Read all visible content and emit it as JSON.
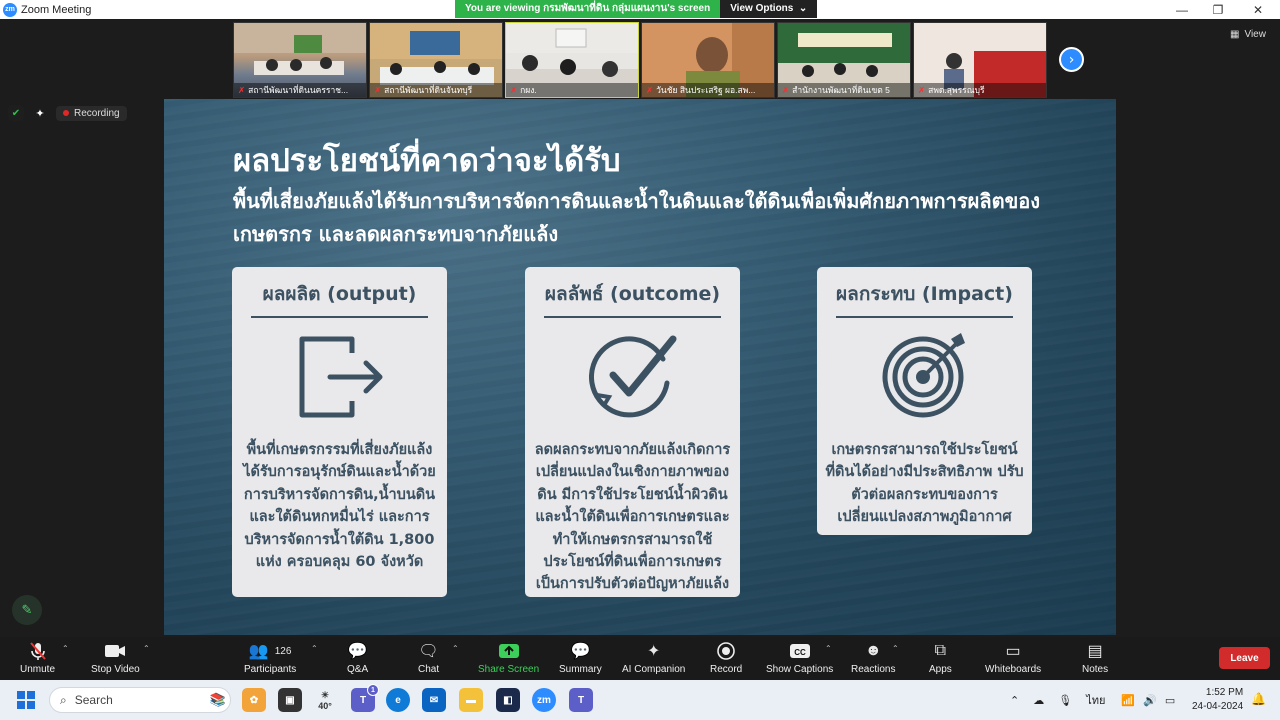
{
  "window": {
    "title": "Zoom Meeting"
  },
  "share_banner": {
    "message": "You are viewing กรมพัฒนาที่ดิน กลุ่มแผนงาน's screen",
    "options_label": "View Options"
  },
  "gallery": {
    "participants": [
      {
        "name": "สถานีพัฒนาที่ดินนครราช..."
      },
      {
        "name": "สถานีพัฒนาที่ดินจันทบุรี"
      },
      {
        "name": "กผง."
      },
      {
        "name": "วันชัย สินประเสริฐ ผอ.สพ..."
      },
      {
        "name": "สำนักงานพัฒนาที่ดินเขต 5"
      },
      {
        "name": "สพด.สุพรรณบุรี"
      }
    ],
    "view_label": "View"
  },
  "status": {
    "recording_label": "Recording"
  },
  "slide": {
    "title": "ผลประโยชน์ที่คาดว่าจะได้รับ",
    "subtitle": "พื้นที่เสี่ยงภัยแล้งได้รับการบริหารจัดการดินและน้ำในดินและใต้ดินเพื่อเพิ่มศักยภาพการผลิตของเกษตรกร และลดผลกระทบจากภัยแล้ง",
    "cards": [
      {
        "title": "ผลผลิต (output)",
        "icon": "exit-icon",
        "body": "พื้นที่เกษตรกรรมที่เสี่ยงภัยแล้งได้รับการอนุรักษ์ดินและน้ำด้วยการบริหารจัดการดิน,น้ำบนดินและใต้ดินหกหมื่นไร่ และการบริหารจัดการน้ำใต้ดิน 1,800 แห่ง ครอบคลุม 60 จังหวัด"
      },
      {
        "title": "ผลลัพธ์ (outcome)",
        "icon": "check-circle-icon",
        "body": "ลดผลกระทบจากภัยแล้งเกิดการเปลี่ยนแปลงในเชิงกายภาพของดิน มีการใช้ประโยชน์น้ำผิวดินและน้ำใต้ดินเพื่อการเกษตรและทำให้เกษตรกรสามารถใช้ประโยชน์ที่ดินเพื่อการเกษตรเป็นการปรับตัวต่อปัญหาภัยแล้ง"
      },
      {
        "title": "ผลกระทบ (Impact)",
        "icon": "target-icon",
        "body": "เกษตรกรสามารถใช้ประโยชน์ที่ดินได้อย่างมีประสิทธิภาพ ปรับตัวต่อผลกระทบของการเปลี่ยนแปลงสภาพภูมิอากาศ"
      }
    ]
  },
  "toolbar": {
    "unmute": "Unmute",
    "stop_video": "Stop Video",
    "participants": "Participants",
    "participants_count": "126",
    "qa": "Q&A",
    "chat": "Chat",
    "share_screen": "Share Screen",
    "summary": "Summary",
    "ai_companion": "AI Companion",
    "record": "Record",
    "show_captions": "Show Captions",
    "reactions": "Reactions",
    "apps": "Apps",
    "whiteboards": "Whiteboards",
    "notes": "Notes",
    "leave": "Leave"
  },
  "taskbar": {
    "search_placeholder": "Search",
    "weather": "40°",
    "teams_badge": "1",
    "language": "ไทย",
    "time": "1:52 PM",
    "date": "24-04-2024"
  },
  "colors": {
    "accent": "#2d8cff",
    "share_green": "#2db34a",
    "leave_red": "#d12b2b",
    "card_text": "#3c5262"
  }
}
